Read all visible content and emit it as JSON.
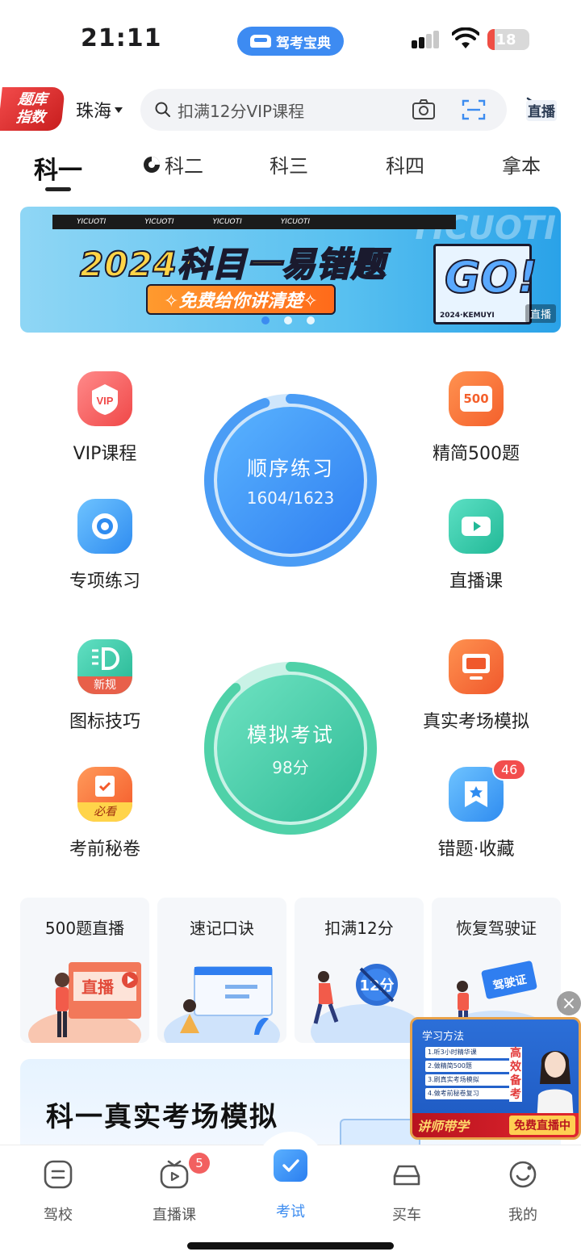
{
  "status": {
    "time": "21:11",
    "app_name": "驾考宝典",
    "battery": "18",
    "battery_level": 0.18
  },
  "header": {
    "ranking_badge": [
      "题库",
      "指数"
    ],
    "city": "珠海",
    "search_placeholder": "扣满12分VIP课程",
    "live_label": "直播"
  },
  "tabs": [
    {
      "label": "科一",
      "active": true
    },
    {
      "label": "科二"
    },
    {
      "label": "科三"
    },
    {
      "label": "科四"
    },
    {
      "label": "拿本"
    }
  ],
  "banner": {
    "ribbon": "YICUOTI",
    "title": "2024科目一易错题",
    "subtitle": "✧免费给你讲清楚✧",
    "go": "GO!",
    "footer_code": "2024·KEMUYI",
    "live_tag": "直播",
    "watermark": "YICUOTI",
    "pages": 3,
    "current_page": 0
  },
  "left_items": [
    {
      "label": "VIP课程",
      "icon": "vip-icon"
    },
    {
      "label": "专项练习",
      "icon": "target-icon"
    },
    {
      "label": "图标技巧",
      "icon": "icon-skill-icon",
      "tag": "新规"
    },
    {
      "label": "考前秘卷",
      "icon": "secret-paper-icon",
      "tag": "必看"
    }
  ],
  "right_items": [
    {
      "label": "精简500题",
      "icon": "500-icon",
      "icon_text": "500"
    },
    {
      "label": "直播课",
      "icon": "video-icon"
    },
    {
      "label": "真实考场模拟",
      "icon": "monitor-icon"
    },
    {
      "label": "错题·收藏",
      "icon": "bookmark-icon",
      "badge": "46"
    }
  ],
  "practice": {
    "title": "顺序练习",
    "progress": "1604/1623",
    "done": 1604,
    "total": 1623
  },
  "mock_exam": {
    "title": "模拟考试",
    "score": "98分"
  },
  "cards": [
    {
      "title": "500题直播",
      "art_text": "直播"
    },
    {
      "title": "速记口诀"
    },
    {
      "title": "扣满12分",
      "art_text": "12分"
    },
    {
      "title": "恢复驾驶证",
      "art_text": "驾驶证"
    }
  ],
  "exam_card": {
    "title": "科一真实考场模拟"
  },
  "floating_live": {
    "title": "学习方法",
    "steps": [
      "1.听3小时精华课",
      "2.做精简500题",
      "3.刷真实考场模拟",
      "4.做考前秘卷复习"
    ],
    "vertical_text": "高效备考",
    "footer_left": "讲师带学",
    "footer_right": "免费直播中"
  },
  "bottom_nav": [
    {
      "label": "驾校",
      "icon": "school-icon"
    },
    {
      "label": "直播课",
      "icon": "tv-icon",
      "badge": "5"
    },
    {
      "label": "考试",
      "icon": "exam-icon",
      "active": true
    },
    {
      "label": "买车",
      "icon": "car-icon"
    },
    {
      "label": "我的",
      "icon": "profile-icon"
    }
  ],
  "colors": {
    "accent": "#3c8cf0",
    "mint": "#4fd1a8",
    "red": "#f24d4d"
  }
}
